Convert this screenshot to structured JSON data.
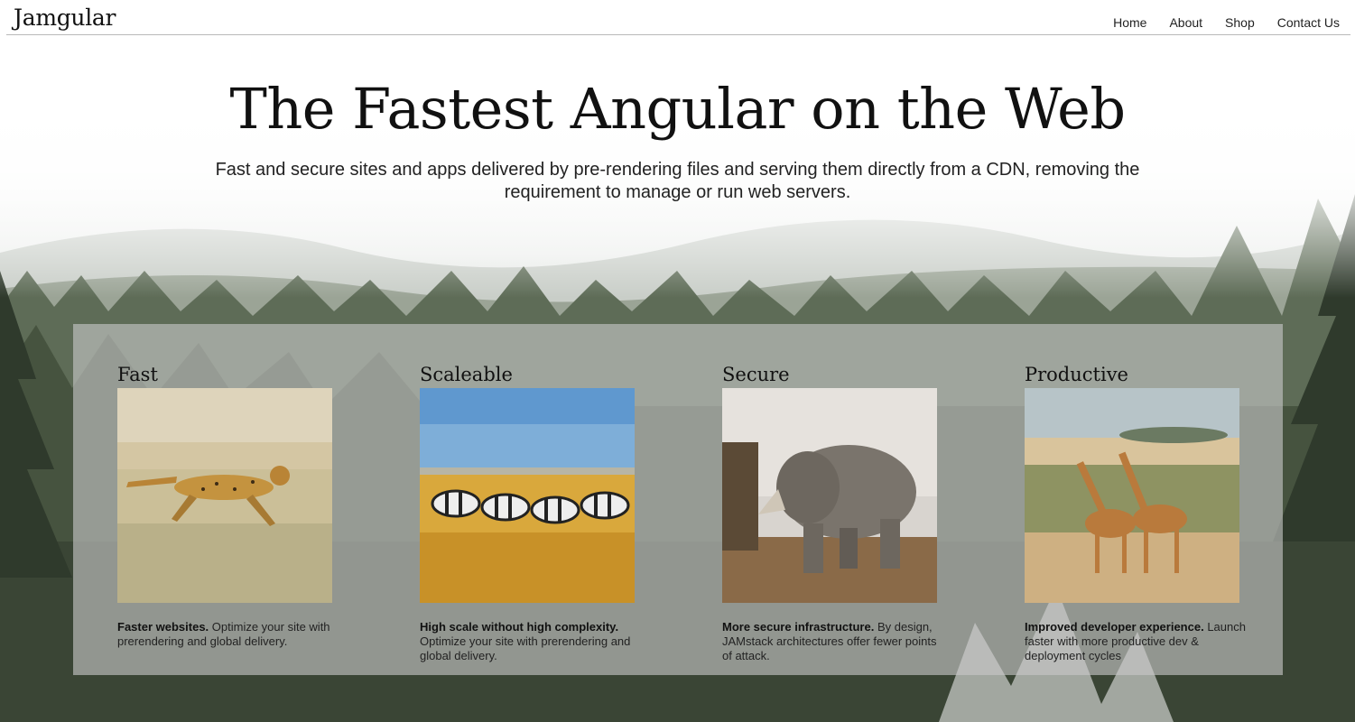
{
  "header": {
    "logo": "Jamgular",
    "nav": [
      "Home",
      "About",
      "Shop",
      "Contact Us"
    ]
  },
  "hero": {
    "title": "The Fastest Angular on the Web",
    "subtitle": "Fast and secure sites and apps delivered by pre-rendering files and serving them directly from a CDN, removing the requirement to manage or run web servers."
  },
  "features": [
    {
      "title": "Fast",
      "image": "cheetah-running-image",
      "bold": "Faster websites.",
      "text": " Optimize your site with prerendering and global delivery."
    },
    {
      "title": "Scaleable",
      "image": "zebras-grassland-image",
      "bold": "High scale without high complexity.",
      "text": " Optimize your site with prerendering and global delivery."
    },
    {
      "title": "Secure",
      "image": "rhino-image",
      "bold": "More secure infrastructure.",
      "text": " By design, JAMstack architectures offer fewer points of attack."
    },
    {
      "title": "Productive",
      "image": "giraffes-savanna-image",
      "bold": "Improved developer experience.",
      "text": " Launch faster with more productive dev & deployment cycles"
    }
  ],
  "colors": {
    "text": "#111111",
    "panel": "#c8c8c8",
    "forest": "#3f4d3c"
  }
}
